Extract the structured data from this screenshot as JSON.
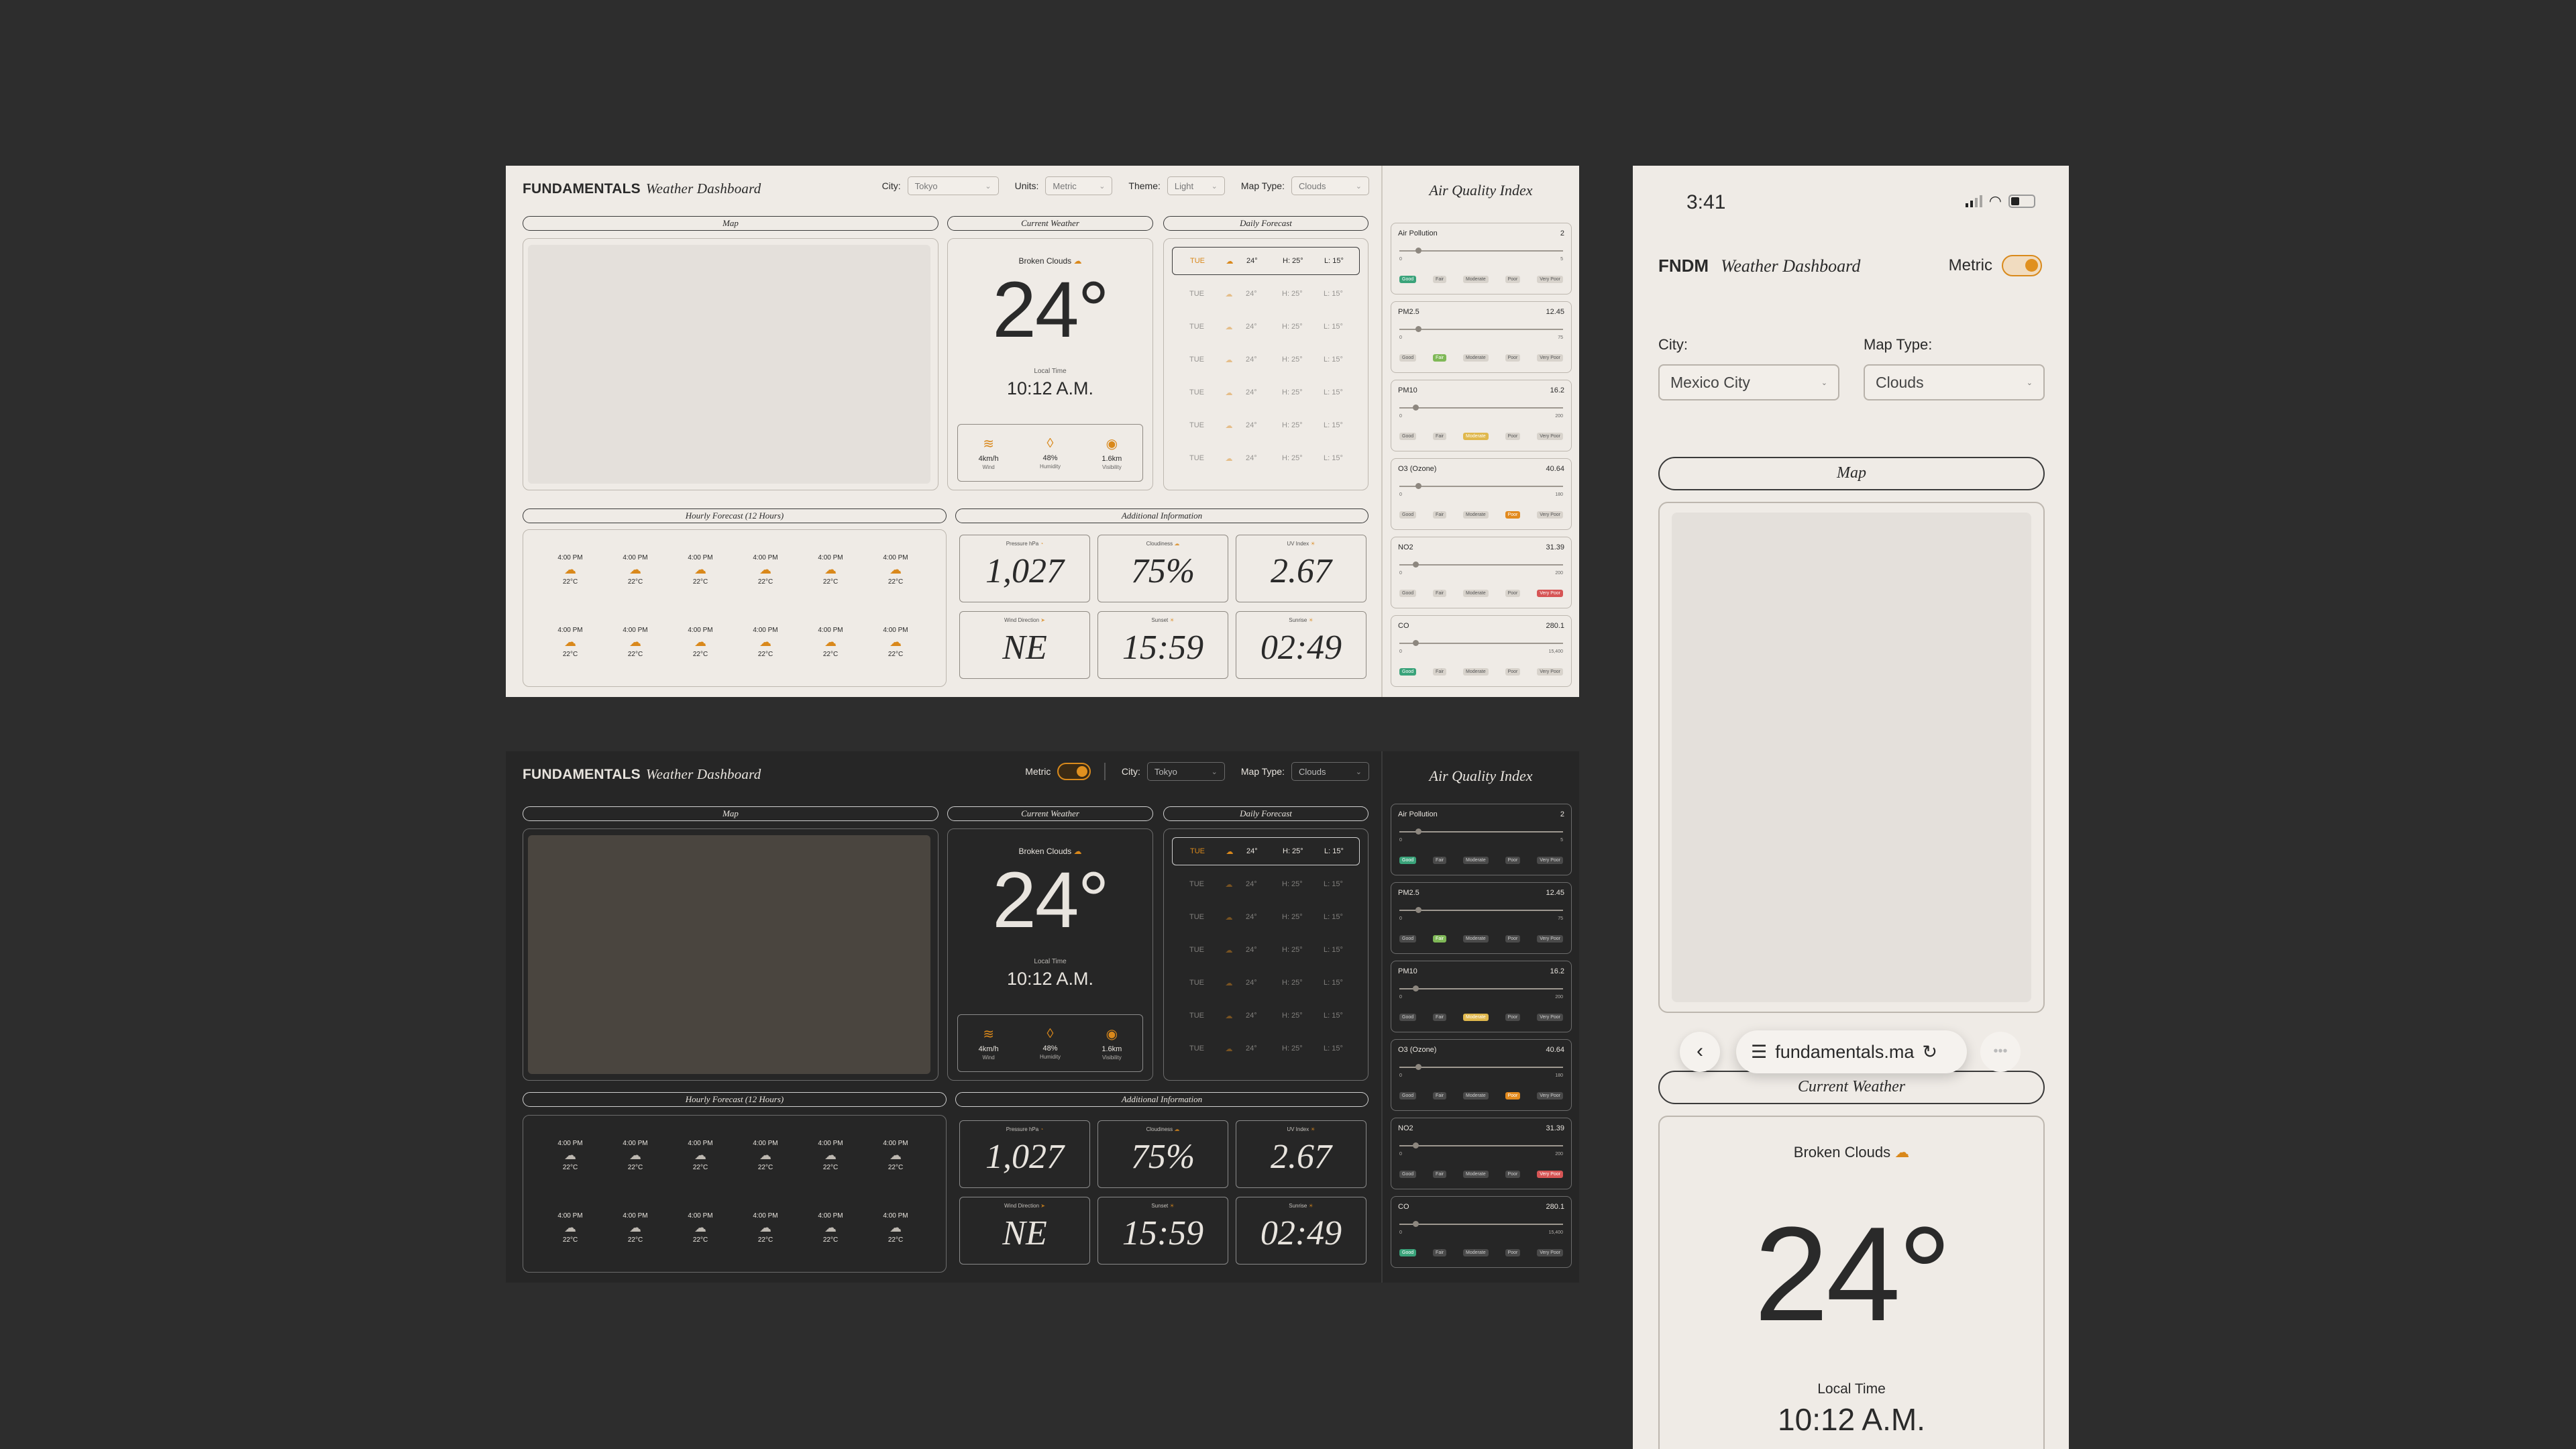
{
  "light": {
    "brand": "FUNDAMENTALS",
    "subtitle": "Weather Dashboard",
    "city_label": "City:",
    "city_value": "Tokyo",
    "units_label": "Units:",
    "units_value": "Metric",
    "theme_label": "Theme:",
    "theme_value": "Light",
    "maptype_label": "Map Type:",
    "maptype_value": "Clouds"
  },
  "dark": {
    "brand": "FUNDAMENTALS",
    "subtitle": "Weather Dashboard",
    "metric_label": "Metric",
    "city_label": "City:",
    "city_value": "Tokyo",
    "maptype_label": "Map Type:",
    "maptype_value": "Clouds"
  },
  "sections": {
    "map": "Map",
    "current": "Current Weather",
    "daily": "Daily Forecast",
    "hourly": "Hourly Forecast (12 Hours)",
    "additional": "Additional Information",
    "aqi": "Air Quality Index"
  },
  "current": {
    "condition": "Broken Clouds",
    "temp": "24°",
    "local_time_label": "Local Time",
    "local_time": "10:12 A.M.",
    "wind": "4km/h",
    "wind_label": "Wind",
    "humidity": "48%",
    "humidity_label": "Humidity",
    "visibility": "1.6km",
    "visibility_label": "Visibility"
  },
  "daily": [
    {
      "day": "TUE",
      "temp": "24°",
      "high": "H: 25°",
      "low": "L: 15°"
    },
    {
      "day": "TUE",
      "temp": "24°",
      "high": "H: 25°",
      "low": "L: 15°"
    },
    {
      "day": "TUE",
      "temp": "24°",
      "high": "H: 25°",
      "low": "L: 15°"
    },
    {
      "day": "TUE",
      "temp": "24°",
      "high": "H: 25°",
      "low": "L: 15°"
    },
    {
      "day": "TUE",
      "temp": "24°",
      "high": "H: 25°",
      "low": "L: 15°"
    },
    {
      "day": "TUE",
      "temp": "24°",
      "high": "H: 25°",
      "low": "L: 15°"
    },
    {
      "day": "TUE",
      "temp": "24°",
      "high": "H: 25°",
      "low": "L: 15°"
    }
  ],
  "hourly": [
    {
      "time": "4:00 PM",
      "temp": "22°C"
    },
    {
      "time": "4:00 PM",
      "temp": "22°C"
    },
    {
      "time": "4:00 PM",
      "temp": "22°C"
    },
    {
      "time": "4:00 PM",
      "temp": "22°C"
    },
    {
      "time": "4:00 PM",
      "temp": "22°C"
    },
    {
      "time": "4:00 PM",
      "temp": "22°C"
    },
    {
      "time": "4:00 PM",
      "temp": "22°C"
    },
    {
      "time": "4:00 PM",
      "temp": "22°C"
    },
    {
      "time": "4:00 PM",
      "temp": "22°C"
    },
    {
      "time": "4:00 PM",
      "temp": "22°C"
    },
    {
      "time": "4:00 PM",
      "temp": "22°C"
    },
    {
      "time": "4:00 PM",
      "temp": "22°C"
    }
  ],
  "additional": [
    {
      "label": "Pressure hPa",
      "value": "1,027"
    },
    {
      "label": "Cloudiness",
      "value": "75%"
    },
    {
      "label": "UV Index",
      "value": "2.67"
    },
    {
      "label": "Wind Direction",
      "value": "NE"
    },
    {
      "label": "Sunset",
      "value": "15:59"
    },
    {
      "label": "Sunrise",
      "value": "02:49"
    }
  ],
  "aqi": [
    {
      "name": "Air Pollution",
      "value": "2",
      "min": "0",
      "max": "5",
      "level": 0.1,
      "active": "good"
    },
    {
      "name": "PM2.5",
      "value": "12.45",
      "min": "0",
      "max": "75",
      "level": 0.1,
      "active": "fair"
    },
    {
      "name": "PM10",
      "value": "16.2",
      "min": "0",
      "max": "200",
      "level": 0.08,
      "active": "mod"
    },
    {
      "name": "O3 (Ozone)",
      "value": "40.64",
      "min": "0",
      "max": "180",
      "level": 0.1,
      "active": "poor"
    },
    {
      "name": "NO2",
      "value": "31.39",
      "min": "0",
      "max": "200",
      "level": 0.08,
      "active": "vpoor"
    },
    {
      "name": "CO",
      "value": "280.1",
      "min": "0",
      "max": "15,400",
      "level": 0.08,
      "active": "good"
    }
  ],
  "aqi_levels": [
    "Good",
    "Fair",
    "Moderate",
    "Poor",
    "Very Poor"
  ],
  "mobile": {
    "clock": "3:41",
    "brand": "FNDM",
    "subtitle": "Weather Dashboard",
    "metric_label": "Metric",
    "city_label": "City:",
    "city_value": "Mexico City",
    "maptype_label": "Map Type:",
    "maptype_value": "Clouds",
    "map_title": "Map",
    "url": "fundamentals.ma",
    "current_title": "Current Weather",
    "condition": "Broken Clouds",
    "temp": "24°",
    "local_time_label": "Local Time",
    "local_time": "10:12 A.M."
  },
  "colors": {
    "accent": "#d9881b",
    "good": "#3aa37a",
    "fair": "#7fb857",
    "moderate": "#e0b84d",
    "poor": "#e28a1e",
    "very_poor": "#d65555"
  }
}
